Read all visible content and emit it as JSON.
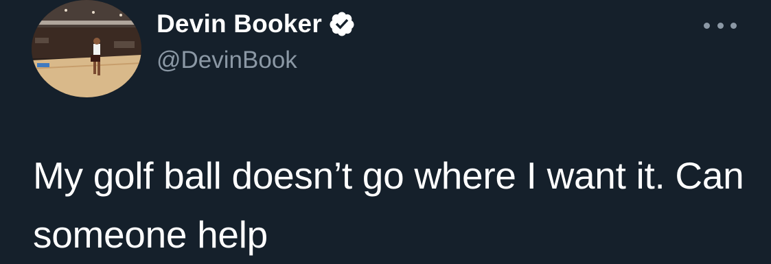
{
  "author": {
    "display_name": "Devin Booker",
    "handle": "@DevinBook",
    "verified": true
  },
  "tweet": {
    "text": "My golf ball doesn’t go where I want it. Can someone help"
  },
  "icons": {
    "verified": "verified-badge-icon",
    "more": "more-options-icon",
    "avatar": "profile-avatar"
  },
  "colors": {
    "background": "#15202b",
    "text": "#ffffff",
    "secondary": "#8b98a5"
  }
}
